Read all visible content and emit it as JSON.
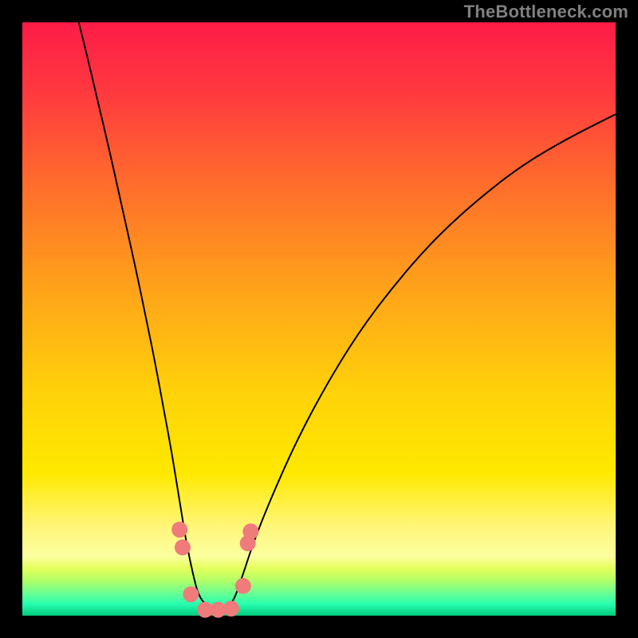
{
  "watermark": "TheBottleneck.com",
  "chart_data": {
    "type": "line",
    "title": "",
    "xlabel": "",
    "ylabel": "",
    "xlim": [
      0,
      1
    ],
    "ylim": [
      0,
      1
    ],
    "background_gradient": {
      "top_color": "#fe1c47",
      "mid_color": "#ffe900",
      "bottom_colors": [
        "#ffe900",
        "#e8ff2a",
        "#b0ff5f",
        "#66ff96",
        "#00ffbb",
        "#00ca7e"
      ]
    },
    "series": [
      {
        "name": "bottleneck-curve",
        "stroke": "#000000",
        "stroke_width": 2,
        "x": [
          0.095,
          0.11,
          0.13,
          0.15,
          0.17,
          0.19,
          0.21,
          0.225,
          0.238,
          0.25,
          0.26,
          0.268,
          0.275,
          0.282,
          0.29,
          0.296,
          0.305,
          0.322,
          0.34,
          0.352,
          0.36,
          0.372,
          0.39,
          0.42,
          0.46,
          0.51,
          0.565,
          0.625,
          0.69,
          0.76,
          0.84,
          0.92,
          1.0
        ],
        "y": [
          1.0,
          0.94,
          0.855,
          0.77,
          0.68,
          0.59,
          0.495,
          0.42,
          0.35,
          0.285,
          0.225,
          0.175,
          0.132,
          0.096,
          0.06,
          0.038,
          0.022,
          0.01,
          0.01,
          0.02,
          0.035,
          0.07,
          0.125,
          0.2,
          0.29,
          0.385,
          0.475,
          0.555,
          0.63,
          0.695,
          0.758,
          0.805,
          0.845
        ]
      }
    ],
    "markers": {
      "name": "pink-markers",
      "fill": "#ef7b7a",
      "points": [
        {
          "x": 0.265,
          "y": 0.145,
          "r": 10
        },
        {
          "x": 0.27,
          "y": 0.115,
          "r": 10
        },
        {
          "x": 0.284,
          "y": 0.036,
          "r": 10
        },
        {
          "x": 0.308,
          "y": 0.01,
          "r": 10
        },
        {
          "x": 0.33,
          "y": 0.01,
          "r": 10
        },
        {
          "x": 0.352,
          "y": 0.012,
          "r": 10
        },
        {
          "x": 0.372,
          "y": 0.05,
          "r": 10
        },
        {
          "x": 0.38,
          "y": 0.122,
          "r": 10
        },
        {
          "x": 0.385,
          "y": 0.142,
          "r": 10
        }
      ]
    },
    "colors": {
      "frame": "#000000",
      "curve": "#000000",
      "marker": "#ef7b7a"
    }
  }
}
